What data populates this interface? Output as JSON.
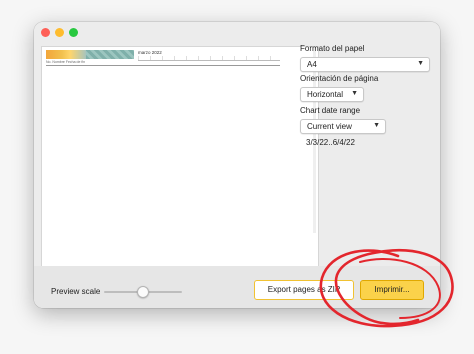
{
  "preview": {
    "gantt_month": "marzo 2022",
    "gantt_cols": "No.   Nombre   Fecha de fin"
  },
  "sidebar": {
    "paper_format_label": "Formato del papel",
    "paper_format_value": "A4",
    "orientation_label": "Orientación de página",
    "orientation_value": "Horizontal",
    "date_range_label": "Chart date range",
    "date_range_value": "Current view",
    "date_range_text": "3/3/22..6/4/22"
  },
  "bottom": {
    "preview_scale_label": "Preview scale",
    "preview_scale_level": 0.5,
    "export_label": "Export pages as ZIP",
    "print_label": "Imprimir..."
  },
  "colors": {
    "print_button": "#fbd24a",
    "annotation": "#e3262d"
  }
}
